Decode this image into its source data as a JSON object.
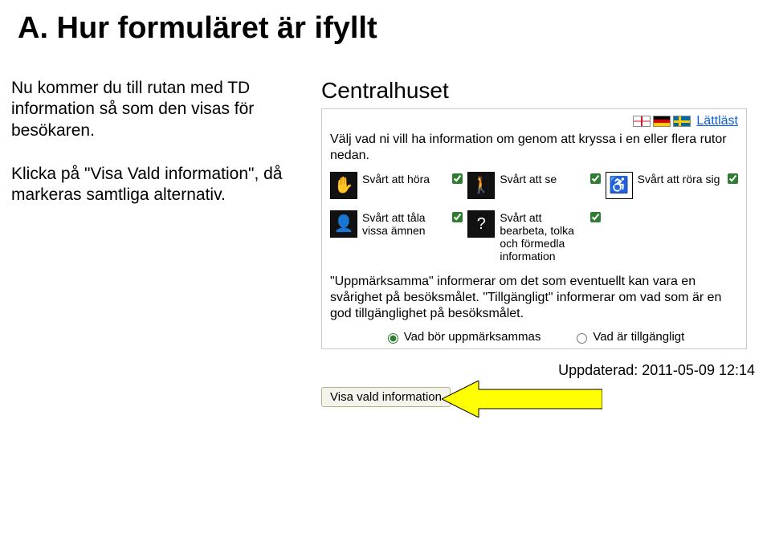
{
  "title": "A. Hur formuläret är ifyllt",
  "left": {
    "p1": "Nu kommer du till rutan med TD information så som den visas för besökaren.",
    "p2": "Klicka på \"Visa Vald information\", då markeras samtliga alternativ."
  },
  "panel": {
    "heading": "Centralhuset",
    "lattlast": "Lättläst",
    "intro": "Välj vad ni vill ha information om genom att kryssa i en eller flera rutor nedan.",
    "options": [
      {
        "label": "Svårt att höra",
        "checked": true
      },
      {
        "label": "Svårt att se",
        "checked": true
      },
      {
        "label": "Svårt att röra sig",
        "checked": true
      },
      {
        "label": "Svårt att tåla vissa ämnen",
        "checked": true
      },
      {
        "label": "Svårt att bearbeta, tolka och förmedla information",
        "checked": true
      },
      {
        "label": "",
        "checked": false
      }
    ],
    "explain": "\"Uppmärksamma\" informerar om det som eventuellt kan vara en svårighet på besöksmålet. \"Tillgängligt\" informerar om vad som är en god tillgänglighet på besöksmålet.",
    "radio1": "Vad bör uppmärksammas",
    "radio2": "Vad är tillgängligt",
    "updated": "Uppdaterad: 2011-05-09 12:14",
    "button": "Visa vald information"
  }
}
